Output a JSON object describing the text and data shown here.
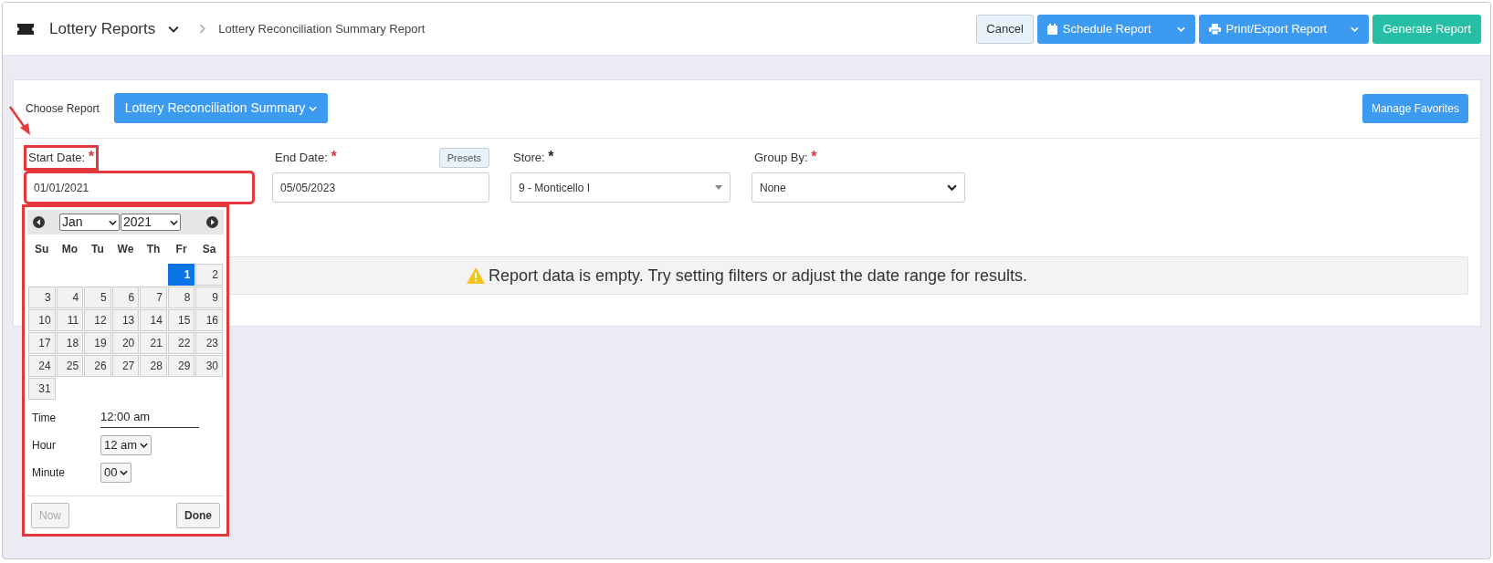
{
  "header": {
    "title": "Lottery Reports",
    "breadcrumb": "Lottery Reconciliation Summary Report",
    "buttons": [
      {
        "label": "Cancel",
        "kind": "cancel"
      },
      {
        "label": "Schedule Report",
        "kind": "schedule"
      },
      {
        "label": "Print/Export Report",
        "kind": "print"
      },
      {
        "label": "Generate Report",
        "kind": "generate"
      }
    ]
  },
  "choose_report": {
    "label": "Choose Report",
    "value": "Lottery Reconciliation Summary",
    "manage_button": "Manage Favorites"
  },
  "pointer_arrow": true,
  "filters": [
    {
      "label": "Start Date:",
      "required": {
        "mark": "*",
        "color": "#dc3545"
      },
      "value": "01/01/2021",
      "kind": "date",
      "highlighted": true
    },
    {
      "label": "End Date:",
      "required": {
        "mark": "*",
        "color": "#dc3545"
      },
      "value": "05/05/2023",
      "kind": "date",
      "presets": "Presets",
      "highlighted": false
    },
    {
      "label": "Store:",
      "required": {
        "mark": "*",
        "color": "#212529"
      },
      "value": "9 - Monticello I",
      "kind": "combo",
      "highlighted": false
    },
    {
      "label": "Group By:",
      "required": {
        "mark": "*",
        "color": "#dc3545"
      },
      "value": "None",
      "kind": "select",
      "highlighted": false
    }
  ],
  "calendar": {
    "highlighted": true,
    "month": "Jan",
    "year": "2021",
    "weekdays": [
      "Su",
      "Mo",
      "Tu",
      "We",
      "Th",
      "Fr",
      "Sa"
    ],
    "weeks": [
      {
        "kind": "end",
        "days": [
          {
            "day": "1",
            "selected": true
          },
          {
            "day": "2",
            "selected": false
          }
        ]
      },
      {
        "kind": "full",
        "days": [
          {
            "day": "3",
            "selected": false
          },
          {
            "day": "4",
            "selected": false
          },
          {
            "day": "5",
            "selected": false
          },
          {
            "day": "6",
            "selected": false
          },
          {
            "day": "7",
            "selected": false
          },
          {
            "day": "8",
            "selected": false
          },
          {
            "day": "9",
            "selected": false
          }
        ]
      },
      {
        "kind": "full",
        "days": [
          {
            "day": "10",
            "selected": false
          },
          {
            "day": "11",
            "selected": false
          },
          {
            "day": "12",
            "selected": false
          },
          {
            "day": "13",
            "selected": false
          },
          {
            "day": "14",
            "selected": false
          },
          {
            "day": "15",
            "selected": false
          },
          {
            "day": "16",
            "selected": false
          }
        ]
      },
      {
        "kind": "full",
        "days": [
          {
            "day": "17",
            "selected": false
          },
          {
            "day": "18",
            "selected": false
          },
          {
            "day": "19",
            "selected": false
          },
          {
            "day": "20",
            "selected": false
          },
          {
            "day": "21",
            "selected": false
          },
          {
            "day": "22",
            "selected": false
          },
          {
            "day": "23",
            "selected": false
          }
        ]
      },
      {
        "kind": "full",
        "days": [
          {
            "day": "24",
            "selected": false
          },
          {
            "day": "25",
            "selected": false
          },
          {
            "day": "26",
            "selected": false
          },
          {
            "day": "27",
            "selected": false
          },
          {
            "day": "28",
            "selected": false
          },
          {
            "day": "29",
            "selected": false
          },
          {
            "day": "30",
            "selected": false
          }
        ]
      },
      {
        "kind": "start",
        "days": [
          {
            "day": "31",
            "selected": false
          }
        ]
      }
    ],
    "time": {
      "label": "Time",
      "value": "12:00 am"
    },
    "hour": {
      "label": "Hour",
      "value": "12 am"
    },
    "minute": {
      "label": "Minute",
      "value": "00"
    },
    "buttons": [
      {
        "label": "Now",
        "disabled": true
      },
      {
        "label": "Done",
        "disabled": false
      }
    ]
  },
  "message": "Report data is empty. Try setting filters or adjust the date range for results."
}
